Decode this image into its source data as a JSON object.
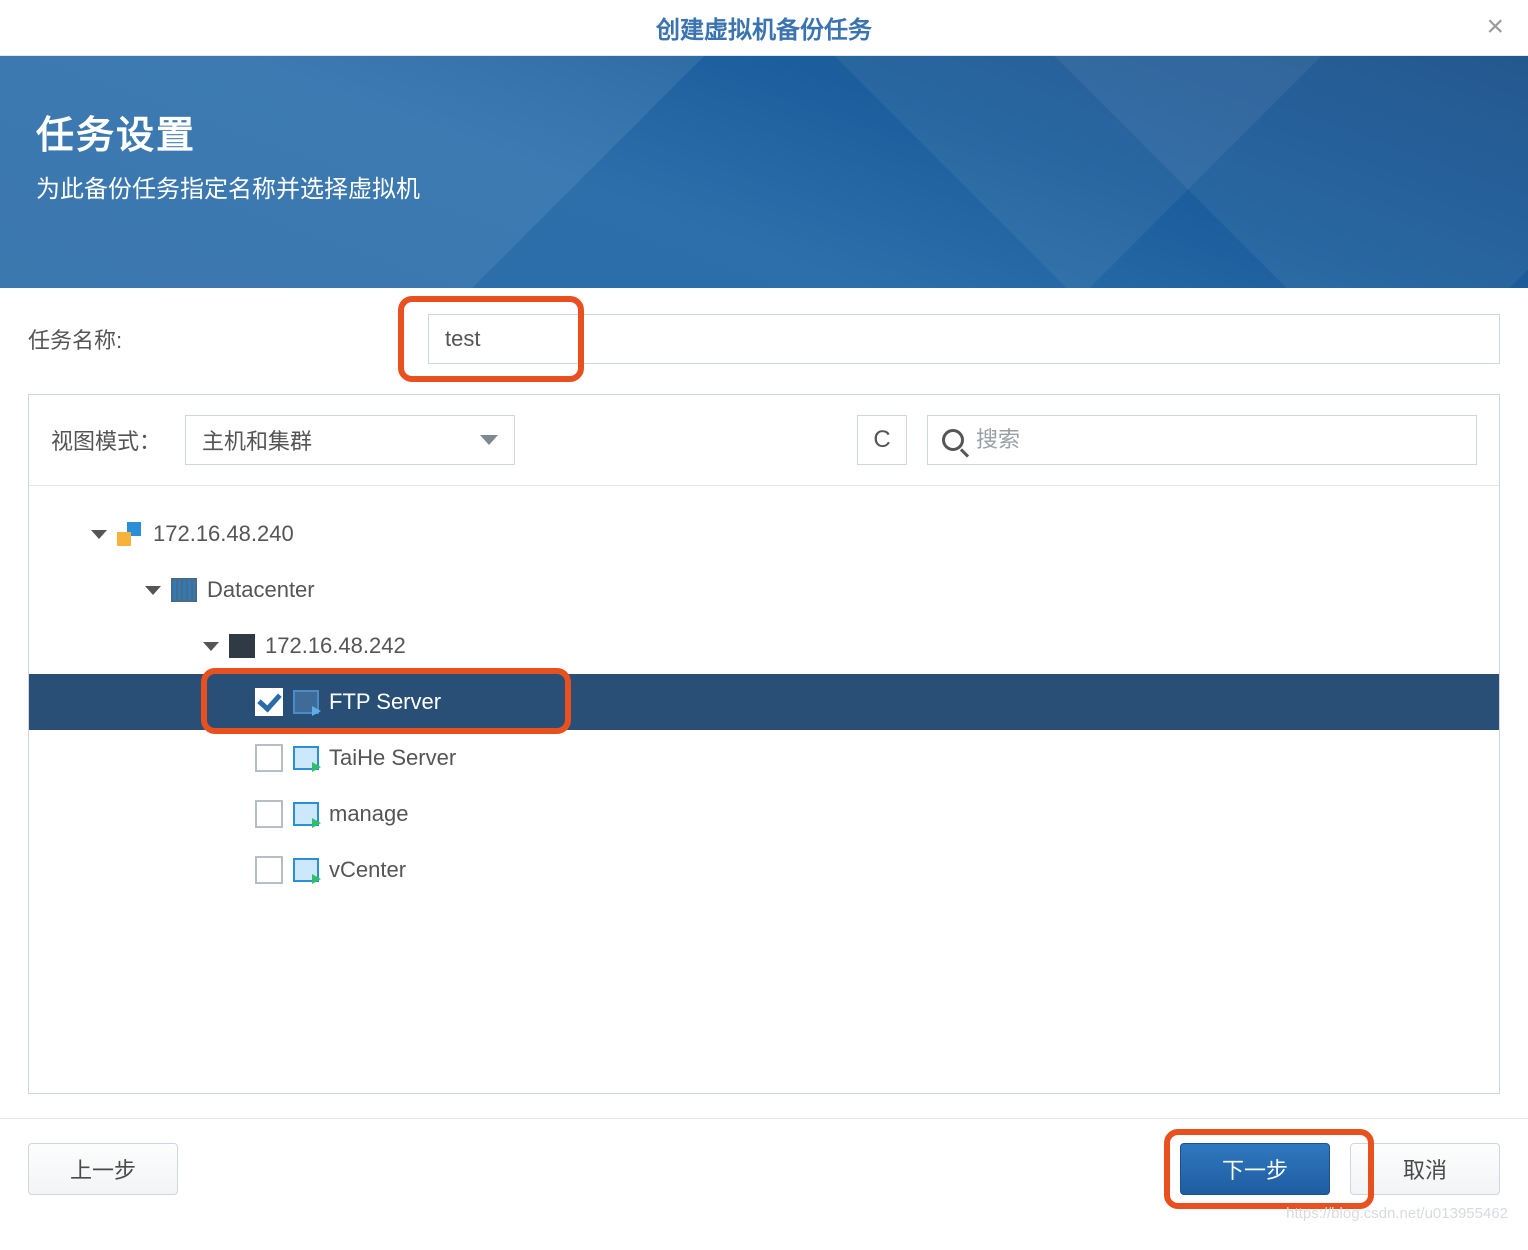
{
  "dialog": {
    "title": "创建虚拟机备份任务"
  },
  "hero": {
    "heading": "任务设置",
    "subtitle": "为此备份任务指定名称并选择虚拟机"
  },
  "form": {
    "task_name_label": "任务名称:",
    "task_name_value": "test"
  },
  "toolbar": {
    "view_mode_label": "视图模式：",
    "view_mode_value": "主机和集群",
    "search_placeholder": "搜索"
  },
  "tree": {
    "root": "172.16.48.240",
    "datacenter": "Datacenter",
    "host": "172.16.48.242",
    "vms": [
      {
        "name": "FTP Server",
        "checked": true,
        "selected": true
      },
      {
        "name": "TaiHe Server",
        "checked": false,
        "selected": false
      },
      {
        "name": "manage",
        "checked": false,
        "selected": false
      },
      {
        "name": "vCenter",
        "checked": false,
        "selected": false
      }
    ]
  },
  "footer": {
    "prev": "上一步",
    "next": "下一步",
    "cancel": "取消"
  },
  "watermark": "https://blog.csdn.net/u013955462"
}
